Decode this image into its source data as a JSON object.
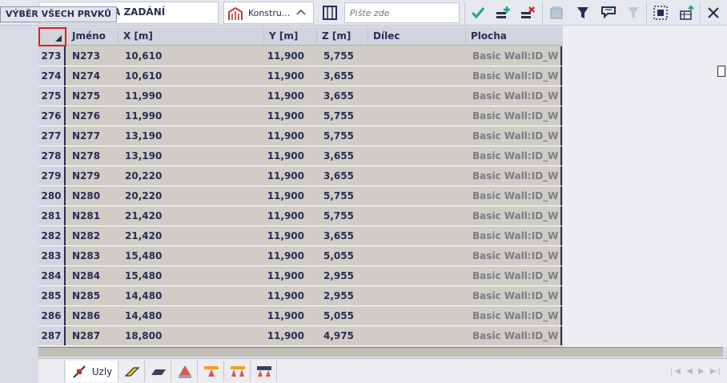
{
  "toolbar": {
    "tab_title": "A ZADÁNÍ",
    "tooltip": "VÝBĚR VŠECH PRVKŮ",
    "dropdown_label": "Konstru...",
    "search_placeholder": "Pište zde"
  },
  "colors": {
    "accent_navy": "#2a2d52",
    "check_green": "#1fa38a",
    "delete_red": "#e0201c"
  },
  "table": {
    "columns": [
      "Jméno",
      "X [m]",
      "Y [m]",
      "Z [m]",
      "Dílec",
      "Plocha"
    ],
    "rows": [
      {
        "idx": "273",
        "name": "N273",
        "x": "10,610",
        "y": "11,900",
        "z": "5,755",
        "dilec": "",
        "plocha": "Basic Wall:ID_W ..."
      },
      {
        "idx": "274",
        "name": "N274",
        "x": "10,610",
        "y": "11,900",
        "z": "3,655",
        "dilec": "",
        "plocha": "Basic Wall:ID_W ..."
      },
      {
        "idx": "275",
        "name": "N275",
        "x": "11,990",
        "y": "11,900",
        "z": "3,655",
        "dilec": "",
        "plocha": "Basic Wall:ID_W ..."
      },
      {
        "idx": "276",
        "name": "N276",
        "x": "11,990",
        "y": "11,900",
        "z": "5,755",
        "dilec": "",
        "plocha": "Basic Wall:ID_W ..."
      },
      {
        "idx": "277",
        "name": "N277",
        "x": "13,190",
        "y": "11,900",
        "z": "5,755",
        "dilec": "",
        "plocha": "Basic Wall:ID_W ..."
      },
      {
        "idx": "278",
        "name": "N278",
        "x": "13,190",
        "y": "11,900",
        "z": "3,655",
        "dilec": "",
        "plocha": "Basic Wall:ID_W ..."
      },
      {
        "idx": "279",
        "name": "N279",
        "x": "20,220",
        "y": "11,900",
        "z": "3,655",
        "dilec": "",
        "plocha": "Basic Wall:ID_W ..."
      },
      {
        "idx": "280",
        "name": "N280",
        "x": "20,220",
        "y": "11,900",
        "z": "5,755",
        "dilec": "",
        "plocha": "Basic Wall:ID_W ..."
      },
      {
        "idx": "281",
        "name": "N281",
        "x": "21,420",
        "y": "11,900",
        "z": "5,755",
        "dilec": "",
        "plocha": "Basic Wall:ID_W ..."
      },
      {
        "idx": "282",
        "name": "N282",
        "x": "21,420",
        "y": "11,900",
        "z": "3,655",
        "dilec": "",
        "plocha": "Basic Wall:ID_W ..."
      },
      {
        "idx": "283",
        "name": "N283",
        "x": "15,480",
        "y": "11,900",
        "z": "5,055",
        "dilec": "",
        "plocha": "Basic Wall:ID_W ..."
      },
      {
        "idx": "284",
        "name": "N284",
        "x": "15,480",
        "y": "11,900",
        "z": "2,955",
        "dilec": "",
        "plocha": "Basic Wall:ID_W ..."
      },
      {
        "idx": "285",
        "name": "N285",
        "x": "14,480",
        "y": "11,900",
        "z": "2,955",
        "dilec": "",
        "plocha": "Basic Wall:ID_W ..."
      },
      {
        "idx": "286",
        "name": "N286",
        "x": "14,480",
        "y": "11,900",
        "z": "5,055",
        "dilec": "",
        "plocha": "Basic Wall:ID_W ..."
      },
      {
        "idx": "287",
        "name": "N287",
        "x": "18,800",
        "y": "11,900",
        "z": "4,975",
        "dilec": "",
        "plocha": "Basic Wall:ID_W ..."
      }
    ]
  },
  "bottom_tabs": {
    "active_label": "Uzly",
    "icons": [
      "node-icon",
      "beam-icon",
      "plate-icon",
      "support-icon",
      "line-support-icon",
      "double-support-icon",
      "hinge-icon"
    ]
  }
}
